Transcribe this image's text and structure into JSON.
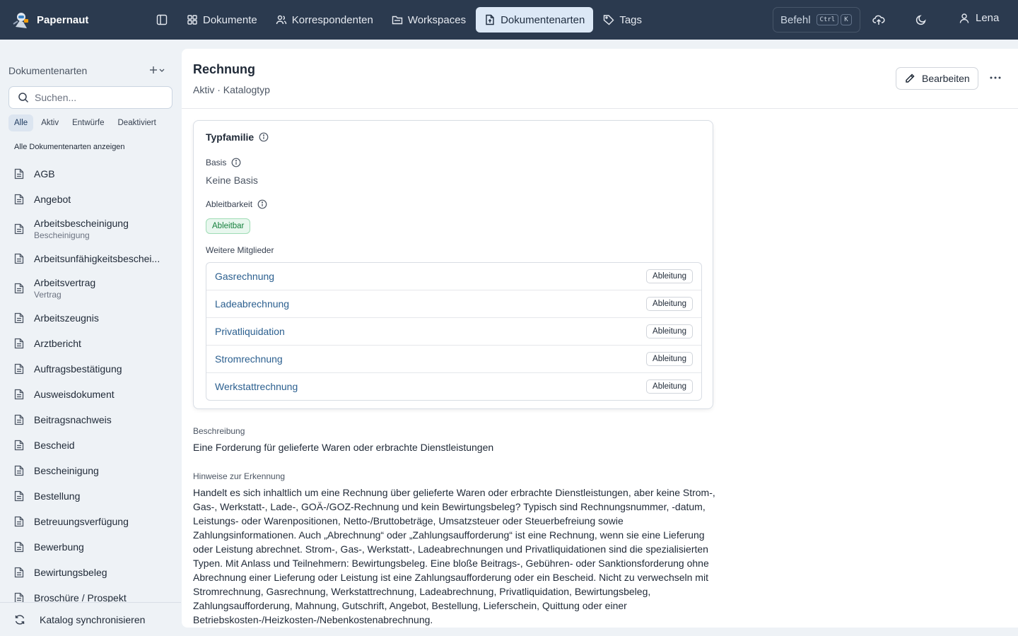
{
  "app": {
    "name": "Papernaut"
  },
  "nav": [
    {
      "label": "Dokumente",
      "icon": "grid-icon",
      "active": false
    },
    {
      "label": "Korrespondenten",
      "icon": "users-icon",
      "active": false
    },
    {
      "label": "Workspaces",
      "icon": "folder-icon",
      "active": false
    },
    {
      "label": "Dokumentenarten",
      "icon": "file-type-icon",
      "active": true
    },
    {
      "label": "Tags",
      "icon": "tag-icon",
      "active": false
    }
  ],
  "command": {
    "label": "Befehl",
    "key1": "Ctrl",
    "key2": "K"
  },
  "user": {
    "name": "Lena"
  },
  "sidebar": {
    "heading": "Dokumentenarten",
    "search_placeholder": "Suchen...",
    "filters": [
      {
        "label": "Alle",
        "active": true
      },
      {
        "label": "Aktiv",
        "active": false
      },
      {
        "label": "Entwürfe",
        "active": false
      },
      {
        "label": "Deaktiviert",
        "active": false
      }
    ],
    "show_all": "Alle Dokumentenarten anzeigen",
    "items": [
      {
        "label": "AGB",
        "sub": ""
      },
      {
        "label": "Angebot",
        "sub": ""
      },
      {
        "label": "Arbeitsbescheinigung",
        "sub": "Bescheinigung"
      },
      {
        "label": "Arbeitsunfähigkeitsbeschei...",
        "sub": ""
      },
      {
        "label": "Arbeitsvertrag",
        "sub": "Vertrag"
      },
      {
        "label": "Arbeitszeugnis",
        "sub": ""
      },
      {
        "label": "Arztbericht",
        "sub": ""
      },
      {
        "label": "Auftragsbestätigung",
        "sub": ""
      },
      {
        "label": "Ausweisdokument",
        "sub": ""
      },
      {
        "label": "Beitragsnachweis",
        "sub": ""
      },
      {
        "label": "Bescheid",
        "sub": ""
      },
      {
        "label": "Bescheinigung",
        "sub": ""
      },
      {
        "label": "Bestellung",
        "sub": ""
      },
      {
        "label": "Betreuungsverfügung",
        "sub": ""
      },
      {
        "label": "Bewerbung",
        "sub": ""
      },
      {
        "label": "Bewirtungsbeleg",
        "sub": ""
      },
      {
        "label": "Broschüre / Prospekt",
        "sub": ""
      }
    ],
    "sync_label": "Katalog synchronisieren"
  },
  "detail": {
    "title": "Rechnung",
    "subtitle": "Aktiv · Katalogtyp",
    "edit_label": "Bearbeiten",
    "family": {
      "title": "Typfamilie",
      "basis_label": "Basis",
      "basis_value": "Keine Basis",
      "derivable_label": "Ableitbarkeit",
      "derivable_badge": "Ableitbar",
      "members_label": "Weitere Mitglieder",
      "members": [
        {
          "name": "Gasrechnung",
          "badge": "Ableitung"
        },
        {
          "name": "Ladeabrechnung",
          "badge": "Ableitung"
        },
        {
          "name": "Privatliquidation",
          "badge": "Ableitung"
        },
        {
          "name": "Stromrechnung",
          "badge": "Ableitung"
        },
        {
          "name": "Werkstattrechnung",
          "badge": "Ableitung"
        }
      ]
    },
    "description_label": "Beschreibung",
    "description": "Eine Forderung für gelieferte Waren oder erbrachte Dienstleistungen",
    "hints_label": "Hinweise zur Erkennung",
    "hints": "Handelt es sich inhaltlich um eine Rechnung über gelieferte Waren oder erbrachte Dienstleistungen, aber keine Strom-, Gas-, Werkstatt-, Lade-, GOÄ-/GOZ-Rechnung und kein Bewirtungsbeleg? Typisch sind Rechnungsnummer, -datum, Leistungs- oder Warenpositionen, Netto-/Bruttobeträge, Umsatzsteuer oder Steuerbefreiung sowie Zahlungsinformationen. Auch „Abrechnung“ oder „Zahlungsaufforderung“ ist eine Rechnung, wenn sie eine Lieferung oder Leistung abrechnet. Strom-, Gas-, Werkstatt-, Ladeabrechnungen und Privatliquidationen sind die spezialisierten Typen. Mit Anlass und Teilnehmern: Bewirtungsbeleg. Eine bloße Beitrags-, Gebühren- oder Sanktionsforderung ohne Abrechnung einer Lieferung oder Leistung ist eine Zahlungsaufforderung oder ein Bescheid. Nicht zu verwechseln mit Stromrechnung, Gasrechnung, Werkstattrechnung, Ladeabrechnung, Privatliquidation, Bewirtungsbeleg, Zahlungsaufforderung, Mahnung, Gutschrift, Angebot, Bestellung, Lieferschein, Quittung oder einer Betriebskosten-/Heizkosten-/Nebenkostenabrechnung."
  },
  "colors": {
    "topbar": "#2b3a4f",
    "accent_link": "#2b5f8f",
    "badge_green": "#15803d"
  }
}
